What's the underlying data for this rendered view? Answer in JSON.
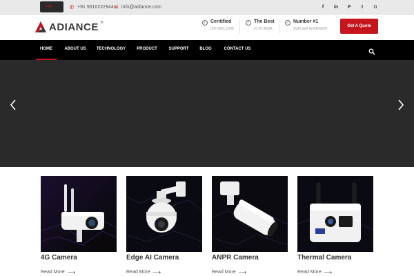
{
  "topbar": {
    "language_label": "india",
    "phone": "+91 9510222944",
    "email": "info@adiance.com",
    "social_icons": [
      "facebook-icon",
      "linkedin-icon",
      "pinterest-icon",
      "twitter-icon",
      "instagram-icon"
    ],
    "social_glyphs": [
      "f",
      "in",
      "P",
      "t",
      "◘"
    ]
  },
  "header": {
    "logo_text": "ADIANCE",
    "logo_mark": "®",
    "badges": [
      {
        "title": "Ceritified",
        "subtitle": "ISO 9001:2008"
      },
      {
        "title": "The Best",
        "subtitle": "#1 IN INDIA"
      },
      {
        "title": "Number #1",
        "subtitle": "SUPLIER IN REGION"
      }
    ],
    "quote_button": "Get A Quote"
  },
  "nav": {
    "items": [
      "HOME",
      "ABOUT US",
      "TECHNOLOGY",
      "PRODUCT",
      "SUPPORT",
      "BLOG",
      "CONTACT US"
    ],
    "active_index": 0
  },
  "products": [
    {
      "title": "4G Camera",
      "link": "Read More"
    },
    {
      "title": "Edge AI Camera",
      "link": "Read More"
    },
    {
      "title": "ANPR Camera",
      "link": "Read More"
    },
    {
      "title": "Thermal Camera",
      "link": "Read More"
    }
  ],
  "colors": {
    "brand_red": "#c4161c",
    "nav_bg": "#000000",
    "hero_bg": "#2a2a2a",
    "topbar_bg": "#e9e9e9"
  }
}
